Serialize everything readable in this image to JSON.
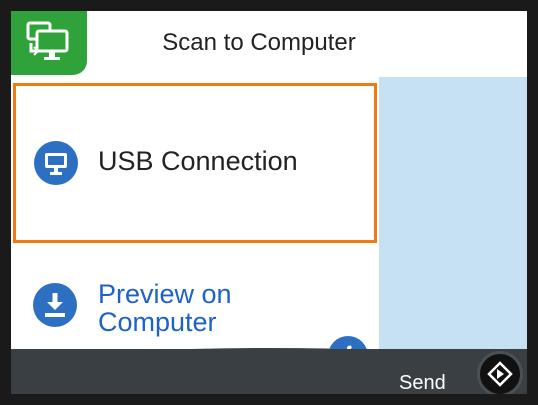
{
  "header": {
    "home_icon": "scan-to-computer-icon",
    "title": "Scan to Computer"
  },
  "items": [
    {
      "icon": "monitor-icon",
      "label": "USB Connection",
      "selected": true
    },
    {
      "icon": "download-icon",
      "label_line1": "Preview on",
      "label_line2": "Computer",
      "selected": false
    }
  ],
  "info": {
    "icon": "info-icon",
    "glyph": "i"
  },
  "footer": {
    "send_label": "Send",
    "send_icon": "start-diamond-icon"
  },
  "colors": {
    "accent": "#2fa33a",
    "selection_border": "#f07b12",
    "link_blue": "#1e62c8",
    "icon_blue": "#2d6fc0",
    "side_panel": "#c6e2f2",
    "footer": "#3a3f44"
  }
}
